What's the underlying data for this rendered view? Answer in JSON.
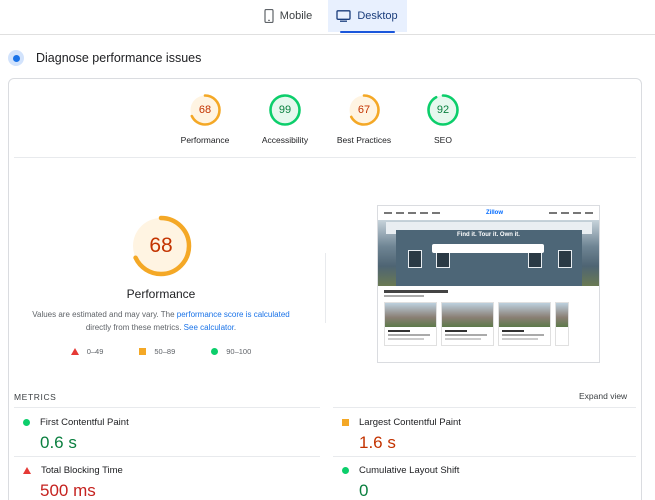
{
  "tabs": [
    {
      "label": "Mobile",
      "icon": "phone-icon",
      "active": false
    },
    {
      "label": "Desktop",
      "icon": "monitor-icon",
      "active": true
    }
  ],
  "diagnose": {
    "title": "Diagnose performance issues"
  },
  "categories": [
    {
      "label": "Performance",
      "score": "68",
      "level": 0.68,
      "color": "#f4a826",
      "text_color": "#c33300"
    },
    {
      "label": "Accessibility",
      "score": "99",
      "level": 0.99,
      "color": "#0cce6b",
      "text_color": "#0a7f3f"
    },
    {
      "label": "Best Practices",
      "score": "67",
      "level": 0.67,
      "color": "#f4a826",
      "text_color": "#c33300"
    },
    {
      "label": "SEO",
      "score": "92",
      "level": 0.92,
      "color": "#0cce6b",
      "text_color": "#0a7f3f"
    }
  ],
  "performance": {
    "score": "68",
    "level": 0.68,
    "title": "Performance",
    "desc_pre": "Values are estimated and may vary. The ",
    "desc_link1": "performance score is calculated",
    "desc_mid": " directly from these metrics. ",
    "desc_link2": "See calculator",
    "desc_end": "."
  },
  "legend": [
    {
      "shape": "triangle",
      "label": "0–49",
      "color": "#e53935"
    },
    {
      "shape": "square",
      "label": "50–89",
      "color": "#f4a826"
    },
    {
      "shape": "circle",
      "label": "90–100",
      "color": "#0cce6b"
    }
  ],
  "screenshot": {
    "logo": "Zillow",
    "hero_text": "Find it. Tour it. Own it."
  },
  "metrics": {
    "label": "METRICS",
    "expand_label": "Expand view",
    "items": [
      {
        "name": "First Contentful Paint",
        "value": "0.6 s",
        "rating": "good",
        "color": "#0a7f3f"
      },
      {
        "name": "Largest Contentful Paint",
        "value": "1.6 s",
        "rating": "average",
        "color": "#c33300"
      },
      {
        "name": "Total Blocking Time",
        "value": "500 ms",
        "rating": "poor",
        "color": "#c5221f"
      },
      {
        "name": "Cumulative Layout Shift",
        "value": "0",
        "rating": "good",
        "color": "#0a7f3f"
      }
    ]
  },
  "colors": {
    "accent": "#1a73e8",
    "good": "#0cce6b",
    "average": "#f4a826",
    "poor": "#e53935"
  }
}
